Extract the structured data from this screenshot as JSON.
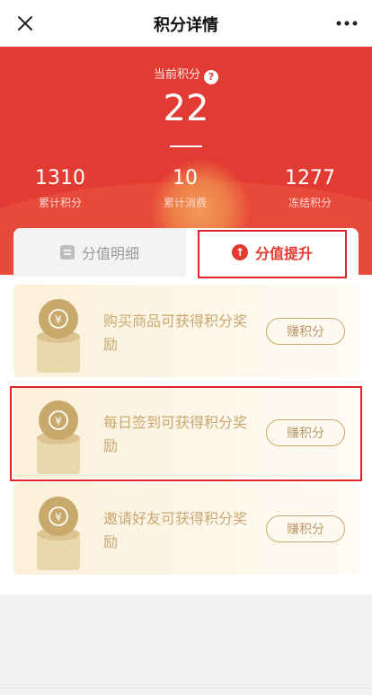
{
  "nav": {
    "title": "积分详情",
    "close_icon": "close-icon",
    "more_icon": "more-icon"
  },
  "hero": {
    "current_label": "当前积分",
    "help_glyph": "?",
    "current_value": "22",
    "stats": [
      {
        "value": "1310",
        "label": "累计积分"
      },
      {
        "value": "10",
        "label": "累计消费"
      },
      {
        "value": "1277",
        "label": "冻结积分"
      }
    ],
    "colors": {
      "primary": "#e23b33",
      "gold": "#c8a870",
      "highlight": "#e0262b"
    }
  },
  "tabs": [
    {
      "label": "分值明细",
      "icon": "list-icon",
      "active": false
    },
    {
      "label": "分值提升",
      "icon": "arrow-up-icon",
      "active": true
    }
  ],
  "tasks": [
    {
      "text": "购买商品可获得积分奖励",
      "button": "赚积分",
      "icon": "coin-icon"
    },
    {
      "text": "每日签到可获得积分奖励",
      "button": "赚积分",
      "icon": "coin-icon"
    },
    {
      "text": "邀请好友可获得积分奖励",
      "button": "赚积分",
      "icon": "coin-icon"
    }
  ]
}
